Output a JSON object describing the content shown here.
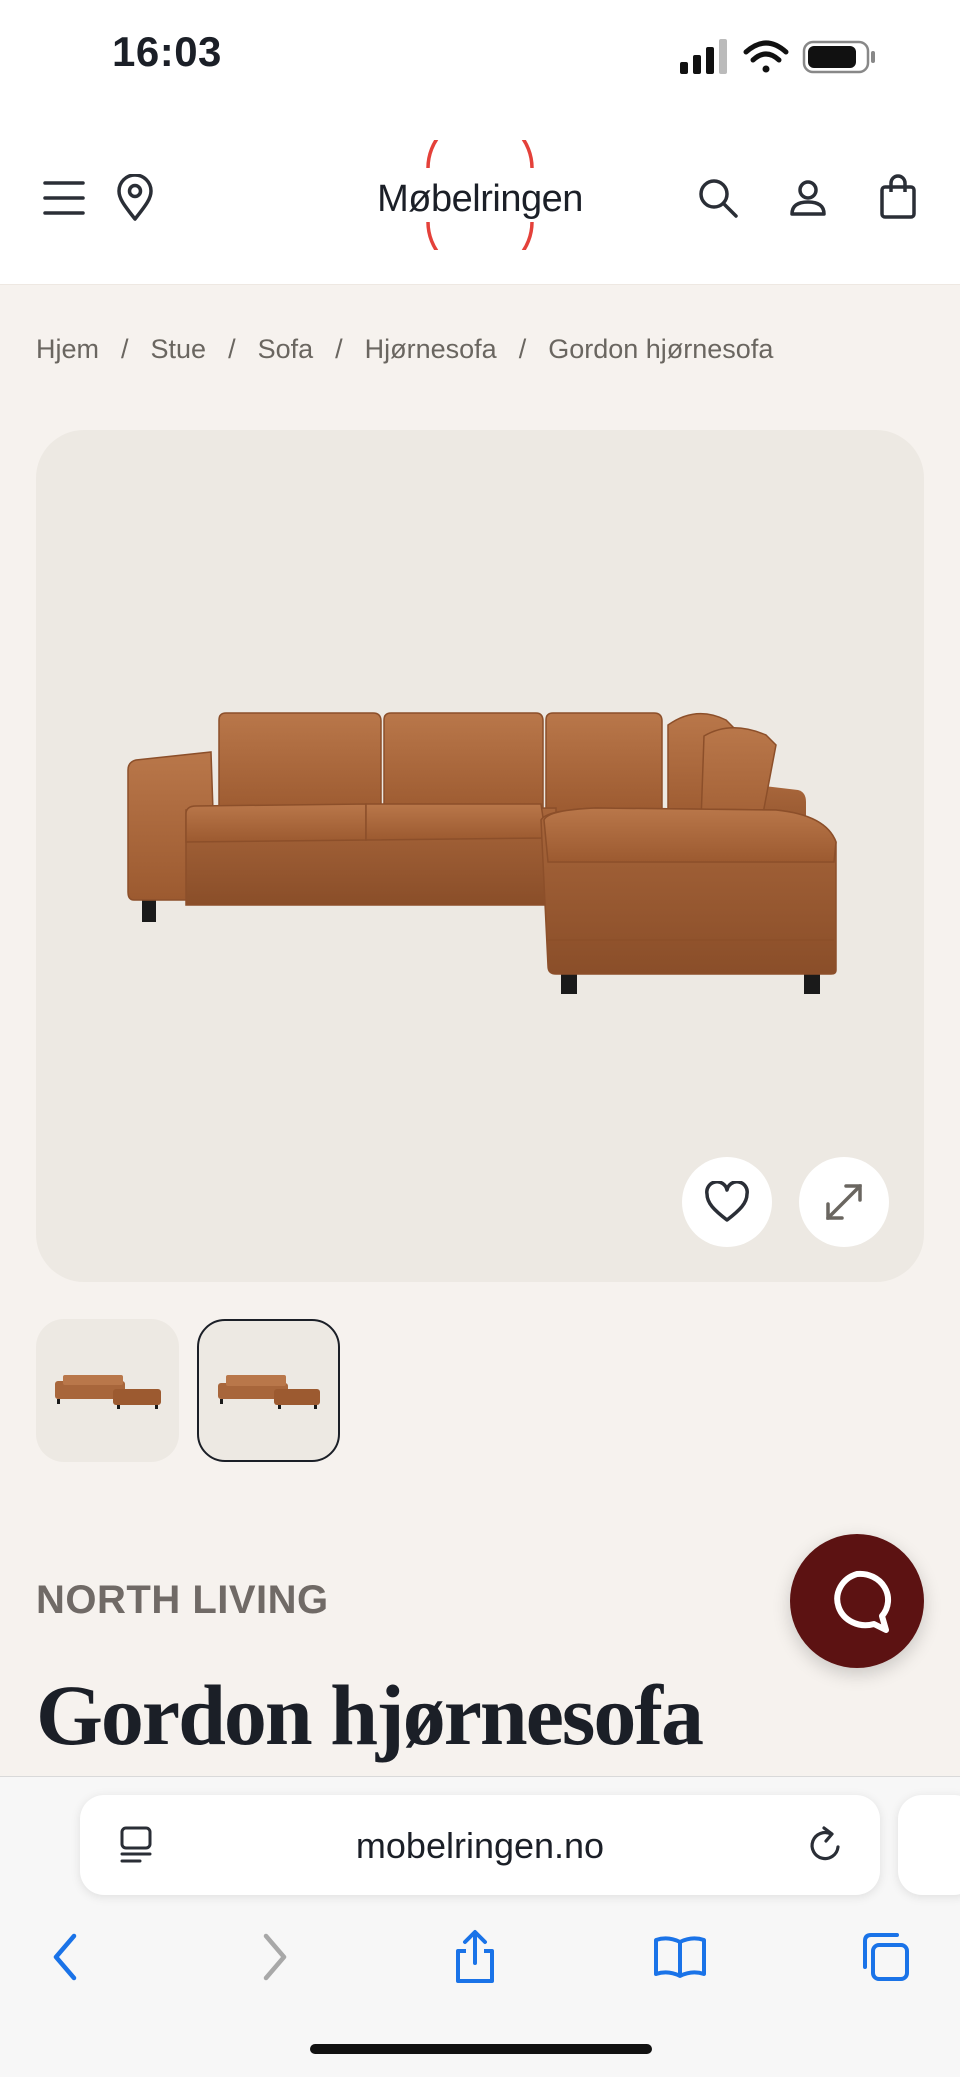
{
  "status_bar": {
    "time": "16:03",
    "icons": [
      "cellular-signal-icon",
      "wifi-icon",
      "battery-icon"
    ]
  },
  "header": {
    "menu_icon": "menu-icon",
    "location_icon": "location-pin-icon",
    "logo_text": "Møbelringen",
    "search_icon": "search-icon",
    "account_icon": "account-icon",
    "cart_icon": "shopping-bag-icon",
    "brand_color": "#e4413a"
  },
  "breadcrumb": {
    "items": [
      "Hjem",
      "Stue",
      "Sofa",
      "Hjørnesofa",
      "Gordon hjørnesofa"
    ],
    "separator": "/"
  },
  "product": {
    "image_subject": "sofa",
    "favorite_icon": "heart-icon",
    "expand_icon": "expand-arrows-icon",
    "thumbnails_selected": 2,
    "brand": "NORTH LIVING",
    "title": "Gordon hjørnesofa",
    "sofa_color": "#b06a3c"
  },
  "chat": {
    "icon": "chat-bubble-icon",
    "color": "#5c1212"
  },
  "browser": {
    "url": "mobelringen.no",
    "reader_icon": "reader-mode-icon",
    "reload_icon": "reload-icon",
    "toolbar": [
      "back-icon",
      "forward-icon",
      "share-icon",
      "bookmarks-icon",
      "tabs-icon"
    ],
    "accent_color": "#1a73e8"
  }
}
